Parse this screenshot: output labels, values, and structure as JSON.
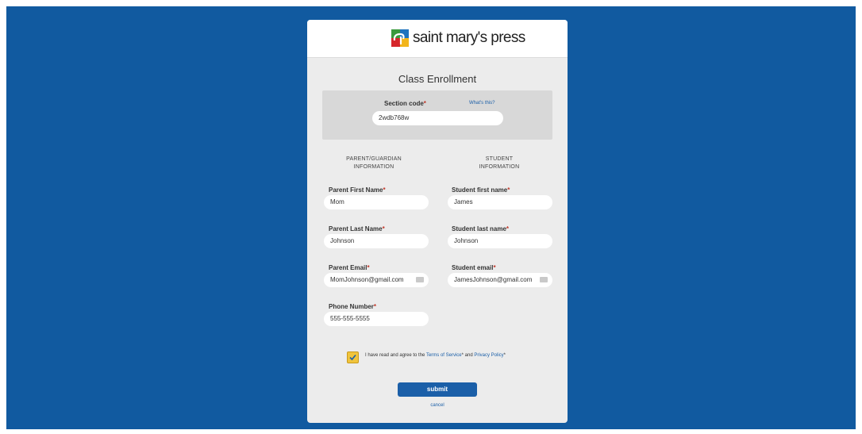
{
  "brand": {
    "logo_text": "saint mary's press",
    "colors": {
      "background": "#115aa0",
      "accent": "#1b5fa8",
      "checkbox": "#f0c43c",
      "required": "#c0392b"
    }
  },
  "form": {
    "title": "Class Enrollment",
    "section_code": {
      "label": "Section code",
      "required_mark": "*",
      "value": "2wdb768w",
      "help_link": "What's this?"
    },
    "parent_heading": [
      "PARENT/GUARDIAN",
      "INFORMATION"
    ],
    "student_heading": [
      "STUDENT",
      "INFORMATION"
    ],
    "parent": {
      "first_name": {
        "label": "Parent First Name",
        "value": "Mom"
      },
      "last_name": {
        "label": "Parent Last Name",
        "value": "Johnson"
      },
      "email": {
        "label": "Parent Email",
        "value": "MomJohnson@gmail.com"
      },
      "phone": {
        "label": "Phone Number",
        "value": "555-555-5555"
      }
    },
    "student": {
      "first_name": {
        "label": "Student first name",
        "value": "James"
      },
      "last_name": {
        "label": "Student last name",
        "value": "Johnson"
      },
      "email": {
        "label": "Student email",
        "value": "JamesJohnson@gmail.com"
      }
    },
    "required_mark": "*",
    "agreement": {
      "checked": true,
      "text_before": "I have read and agree to the ",
      "terms_link": "Terms of Service",
      "text_middle": "* and ",
      "privacy_link": "Privacy Policy",
      "text_after": "*"
    },
    "submit_label": "submit",
    "cancel_label": "cancel"
  }
}
